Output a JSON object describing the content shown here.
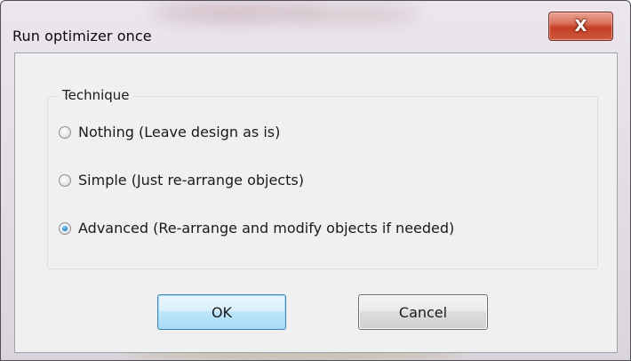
{
  "window": {
    "title": "Run optimizer once",
    "close_label": "X"
  },
  "technique": {
    "legend": "Technique",
    "options": [
      {
        "label": "Nothing (Leave design as is)",
        "checked": false
      },
      {
        "label": "Simple (Just re-arrange objects)",
        "checked": false
      },
      {
        "label": "Advanced (Re-arrange and modify objects if needed)",
        "checked": true
      }
    ]
  },
  "buttons": {
    "ok_label": "OK",
    "cancel_label": "Cancel"
  },
  "colors": {
    "close_button": "#c53e24",
    "default_button_border": "#3c7fb1",
    "radio_selected": "#2f8fd8",
    "dialog_background": "#f0f0f0"
  },
  "icons": {
    "close": "close-icon"
  }
}
